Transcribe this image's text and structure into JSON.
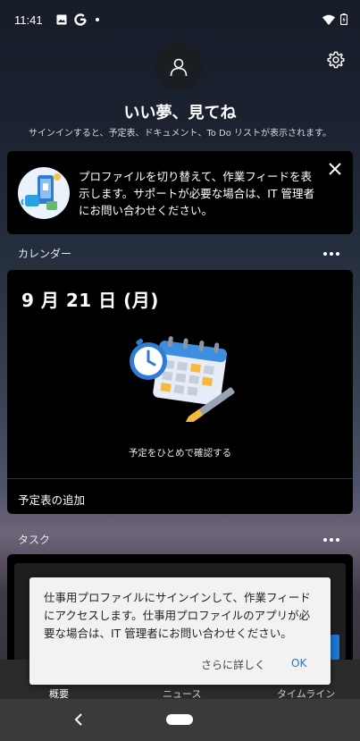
{
  "status_bar": {
    "time": "11:41",
    "icons_left": [
      "image-icon",
      "google-icon",
      "dot-icon"
    ],
    "icons_right": [
      "wifi-icon",
      "battery-icon"
    ]
  },
  "header": {
    "greeting": "いい夢、見てね",
    "subtitle": "サインインすると、予定表、ドキュメント、To Do リストが表示されます。"
  },
  "profile_card": {
    "text": "プロファイルを切り替えて、作業フィードを表示します。サポートが必要な場合は、IT 管理者にお問い合わせください。"
  },
  "calendar": {
    "section_title": "カレンダー",
    "date": "9 月 21 日 (月)",
    "caption": "予定をひとめで確認する",
    "add_label": "予定表の追加"
  },
  "tasks": {
    "section_title": "タスク"
  },
  "dialog": {
    "message": "仕事用プロファイルにサインインして、作業フィードにアクセスします。仕事用プロファイルのアプリが必要な場合は、IT 管理者にお問い合わせください。",
    "more_label": "さらに詳しく",
    "ok_label": "OK"
  },
  "tabs": [
    {
      "label": "概要",
      "active": true
    },
    {
      "label": "ニュース",
      "active": false
    },
    {
      "label": "タイムライン",
      "active": false
    }
  ],
  "colors": {
    "accent": "#1a73e8",
    "card_bg": "#000000",
    "dialog_bg": "#f2f2f2"
  }
}
